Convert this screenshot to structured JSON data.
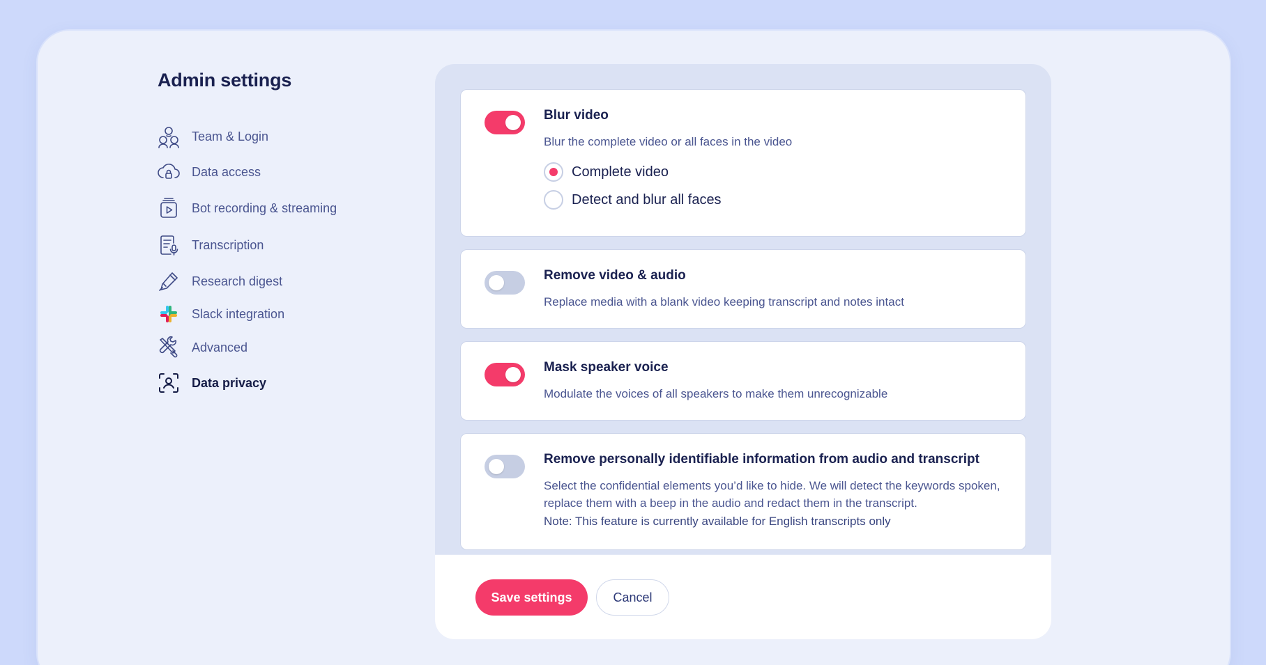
{
  "page": {
    "title": "Admin settings"
  },
  "sidebar": {
    "items": [
      {
        "label": "Team & Login",
        "icon": "team-icon",
        "active": false
      },
      {
        "label": "Data access",
        "icon": "cloud-lock-icon",
        "active": false
      },
      {
        "label": "Bot recording & streaming",
        "icon": "recording-icon",
        "active": false
      },
      {
        "label": "Transcription",
        "icon": "transcription-icon",
        "active": false
      },
      {
        "label": "Research digest",
        "icon": "pen-icon",
        "active": false
      },
      {
        "label": "Slack integration",
        "icon": "slack-icon",
        "active": false
      },
      {
        "label": "Advanced",
        "icon": "tools-icon",
        "active": false
      },
      {
        "label": "Data privacy",
        "icon": "face-scan-icon",
        "active": true
      }
    ]
  },
  "settings": {
    "blur_video": {
      "title": "Blur video",
      "description": "Blur the complete video or all faces in the video",
      "enabled": true,
      "options": [
        {
          "label": "Complete video",
          "selected": true
        },
        {
          "label": "Detect and blur all faces",
          "selected": false
        }
      ]
    },
    "remove_media": {
      "title": "Remove video & audio",
      "description": "Replace media with a blank video keeping transcript and notes intact",
      "enabled": false
    },
    "mask_voice": {
      "title": "Mask speaker voice",
      "description": "Modulate the voices of all speakers to make them unrecognizable",
      "enabled": true
    },
    "remove_pii": {
      "title": "Remove personally identifiable information from audio and transcript",
      "description": "Select the confidential elements you’d like to hide. We will detect the keywords spoken, replace them with a beep in the audio and redact them in the transcript.",
      "note": "Note: This feature is currently available for English transcripts only",
      "enabled": false
    }
  },
  "footer": {
    "save_label": "Save settings",
    "cancel_label": "Cancel"
  },
  "colors": {
    "accent": "#f43b6a",
    "background": "#cdd9fb",
    "window": "#ecf0fb",
    "text_primary": "#1a2150",
    "text_secondary": "#4a5590"
  }
}
